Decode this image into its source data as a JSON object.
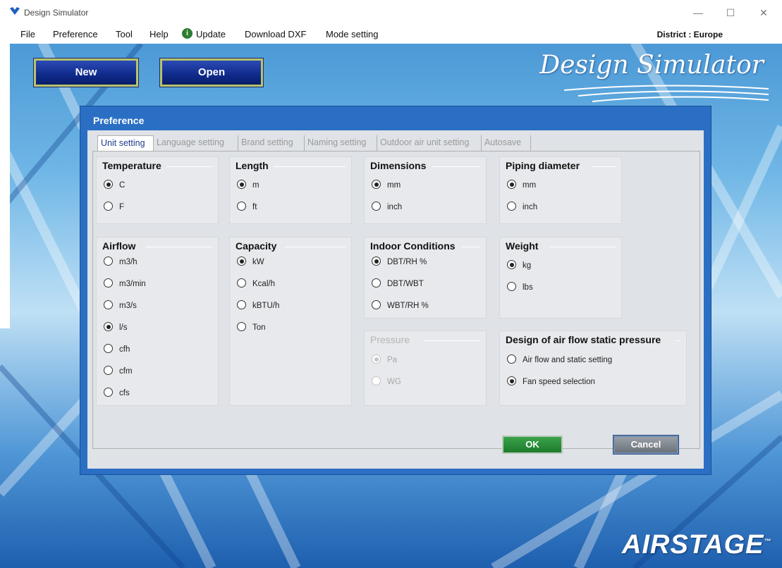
{
  "window": {
    "title": "Design Simulator",
    "minimize": "—",
    "maximize": "☐",
    "close": "✕"
  },
  "menu": {
    "items": [
      "File",
      "Preference",
      "Tool",
      "Help",
      "Update",
      "Download DXF",
      "Mode setting"
    ],
    "district": "District : Europe"
  },
  "toolbar": {
    "new_label": "New",
    "open_label": "Open"
  },
  "brand": {
    "name": "Design Simulator",
    "footer_logo": "AIRSTAGE",
    "tm": "™"
  },
  "dialog": {
    "title": "Preference",
    "tabs": [
      "Unit setting",
      "Language setting",
      "Brand setting",
      "Naming setting",
      "Outdoor air unit setting",
      "Autosave"
    ],
    "active_tab": "Unit setting",
    "groups": {
      "temperature": {
        "title": "Temperature",
        "options": [
          "C",
          "F"
        ],
        "selected": "C"
      },
      "length": {
        "title": "Length",
        "options": [
          "m",
          "ft"
        ],
        "selected": "m"
      },
      "dimensions": {
        "title": "Dimensions",
        "options": [
          "mm",
          "inch"
        ],
        "selected": "mm"
      },
      "piping": {
        "title": "Piping diameter",
        "options": [
          "mm",
          "inch"
        ],
        "selected": "mm"
      },
      "airflow": {
        "title": "Airflow",
        "options": [
          "m3/h",
          "m3/min",
          "m3/s",
          "l/s",
          "cfh",
          "cfm",
          "cfs"
        ],
        "selected": "l/s"
      },
      "capacity": {
        "title": "Capacity",
        "options": [
          "kW",
          "Kcal/h",
          "kBTU/h",
          "Ton"
        ],
        "selected": "kW"
      },
      "indoor": {
        "title": "Indoor Conditions",
        "options": [
          "DBT/RH %",
          "DBT/WBT",
          "WBT/RH %"
        ],
        "selected": "DBT/RH %"
      },
      "weight": {
        "title": "Weight",
        "options": [
          "kg",
          "lbs"
        ],
        "selected": "kg"
      },
      "pressure": {
        "title": "Pressure",
        "options": [
          "Pa",
          "WG"
        ],
        "selected": "Pa",
        "disabled": true
      },
      "design": {
        "title": "Design of air flow static pressure",
        "options": [
          "Air flow and static setting",
          "Fan speed selection"
        ],
        "selected": "Fan speed selection"
      }
    },
    "ok_label": "OK",
    "cancel_label": "Cancel"
  }
}
